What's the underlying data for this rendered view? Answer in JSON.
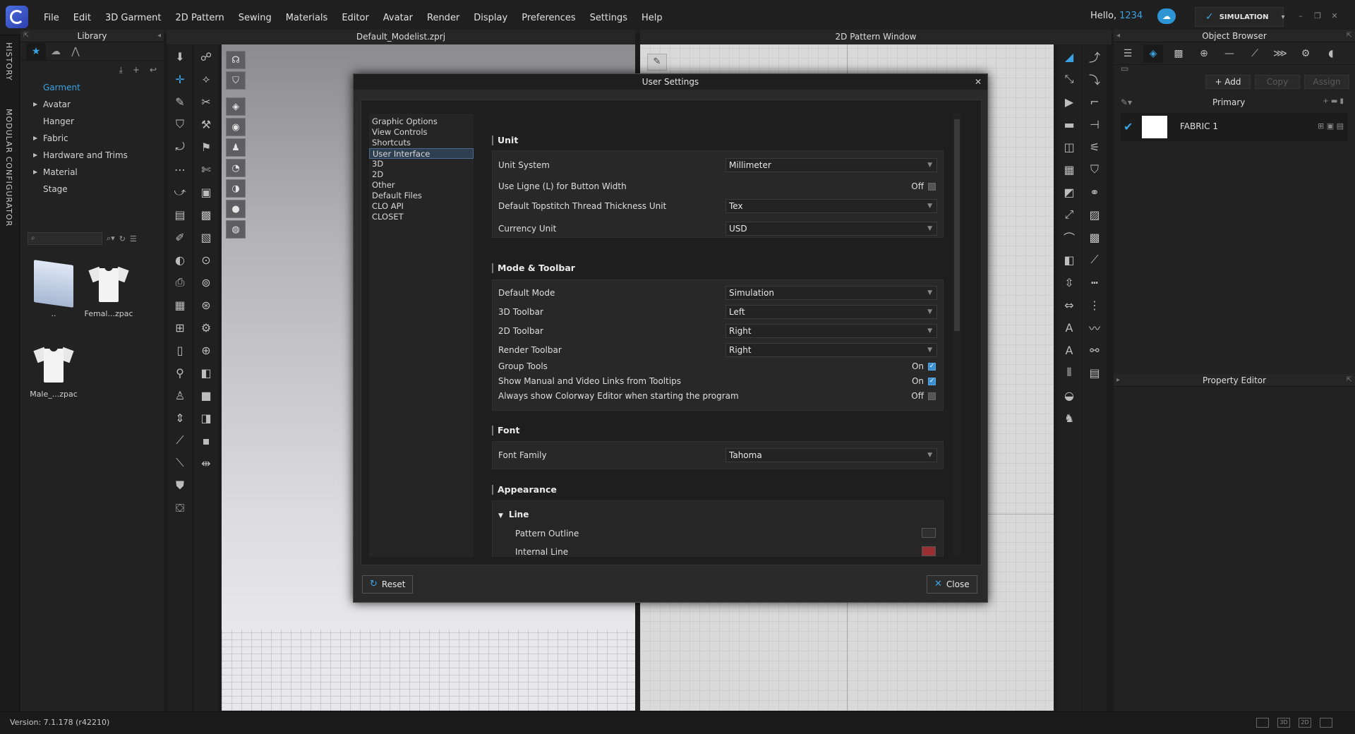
{
  "app": {
    "menu": [
      "File",
      "Edit",
      "3D Garment",
      "2D Pattern",
      "Sewing",
      "Materials",
      "Editor",
      "Avatar",
      "Render",
      "Display",
      "Preferences",
      "Settings",
      "Help"
    ],
    "greeting": "Hello,",
    "user_id": "1234",
    "mode_button": "SIMULATION",
    "accent": "#3aa3e3"
  },
  "sidebar_tabs": {
    "history": "HISTORY",
    "modular": "MODULAR CONFIGURATOR"
  },
  "library": {
    "title": "Library",
    "tree": [
      {
        "label": "Garment",
        "expandable": false,
        "selected": true
      },
      {
        "label": "Avatar",
        "expandable": true,
        "selected": false
      },
      {
        "label": "Hanger",
        "expandable": false,
        "selected": false
      },
      {
        "label": "Fabric",
        "expandable": true,
        "selected": false
      },
      {
        "label": "Hardware and Trims",
        "expandable": true,
        "selected": false
      },
      {
        "label": "Material",
        "expandable": true,
        "selected": false
      },
      {
        "label": "Stage",
        "expandable": false,
        "selected": false
      }
    ],
    "items": [
      {
        "label": "..",
        "kind": "folder"
      },
      {
        "label": "Femal...zpac",
        "kind": "garment"
      },
      {
        "label": "Male_...zpac",
        "kind": "garment"
      }
    ]
  },
  "viewport3d": {
    "title": "Default_Modelist.zprj"
  },
  "viewport2d": {
    "title": "2D Pattern Window"
  },
  "object_browser": {
    "title": "Object Browser",
    "add": "+ Add",
    "copy": "Copy",
    "assign": "Assign",
    "group": "Primary",
    "fabric": "FABRIC 1"
  },
  "property_editor": {
    "title": "Property Editor"
  },
  "status": {
    "version": "Version: 7.1.178 (r42210)",
    "view_2d": "2D",
    "view_3d": "3D"
  },
  "dialog": {
    "title": "User Settings",
    "categories": [
      {
        "label": "Graphic Options",
        "selected": false
      },
      {
        "label": "View Controls",
        "selected": false
      },
      {
        "label": "Shortcuts",
        "selected": false
      },
      {
        "label": "User Interface",
        "selected": true
      },
      {
        "label": "3D",
        "selected": false
      },
      {
        "label": "2D",
        "selected": false
      },
      {
        "label": "Other",
        "selected": false
      },
      {
        "label": "Default Files",
        "selected": false
      },
      {
        "label": "CLO API",
        "selected": false
      },
      {
        "label": "CLOSET",
        "selected": false
      }
    ],
    "unit": {
      "heading": "Unit",
      "unit_system": {
        "label": "Unit System",
        "value": "Millimeter"
      },
      "ligne": {
        "label": "Use Ligne (L) for Button Width",
        "state": "Off",
        "checked": false
      },
      "topstitch": {
        "label": "Default Topstitch Thread Thickness Unit",
        "value": "Tex"
      },
      "currency": {
        "label": "Currency Unit",
        "value": "USD"
      }
    },
    "mode_toolbar": {
      "heading": "Mode & Toolbar",
      "default_mode": {
        "label": "Default Mode",
        "value": "Simulation"
      },
      "toolbar3d": {
        "label": "3D Toolbar",
        "value": "Left"
      },
      "toolbar2d": {
        "label": "2D Toolbar",
        "value": "Right"
      },
      "render_toolbar": {
        "label": "Render Toolbar",
        "value": "Right"
      },
      "group_tools": {
        "label": "Group Tools",
        "state": "On",
        "checked": true
      },
      "manual_links": {
        "label": "Show Manual and Video Links from Tooltips",
        "state": "On",
        "checked": true
      },
      "colorway": {
        "label": "Always show Colorway Editor when starting the program",
        "state": "Off",
        "checked": false
      }
    },
    "font": {
      "heading": "Font",
      "family": {
        "label": "Font Family",
        "value": "Tahoma"
      }
    },
    "appearance": {
      "heading": "Appearance",
      "line_heading": "Line",
      "pattern_outline": {
        "label": "Pattern Outline",
        "color": "#2f2f2f"
      },
      "internal_line": {
        "label": "Internal Line",
        "color": "#9a2f33"
      }
    },
    "reset": "Reset",
    "close": "Close"
  }
}
